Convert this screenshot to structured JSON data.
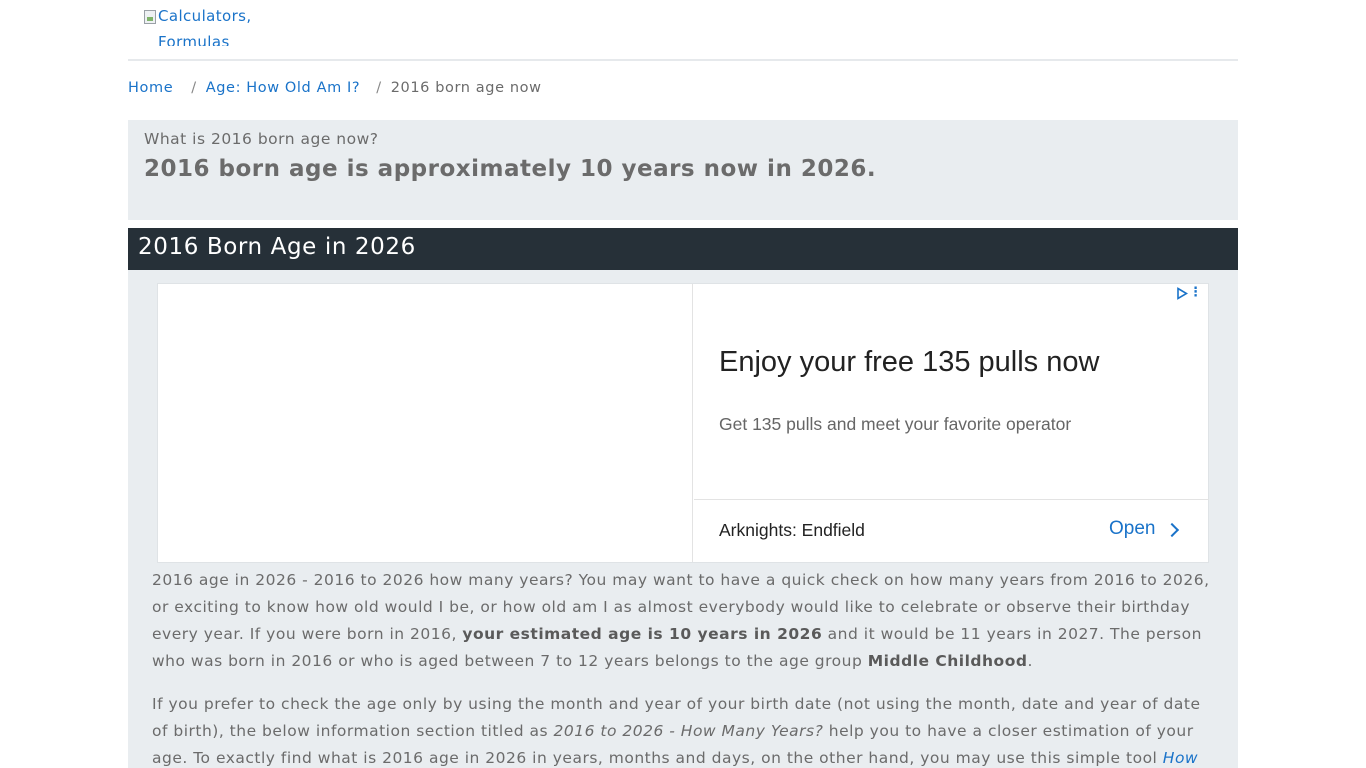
{
  "header": {
    "logo_alt": "Calculators, Formulas and"
  },
  "breadcrumb": {
    "home": "Home",
    "parent": "Age: How Old Am I?",
    "separator": "/",
    "current": "2016 born age now"
  },
  "answer": {
    "question": "What is 2016 born age now?",
    "text": "2016 born age is approximately 10 years now in 2026."
  },
  "section": {
    "title": "2016 Born Age in 2026"
  },
  "ad": {
    "headline": "Enjoy your free 135 pulls now",
    "description": "Get 135 pulls and meet your favorite operator",
    "advertiser": "Arknights: Endfield",
    "cta": "Open",
    "adchoices_icon": "adchoices-icon",
    "menu_icon": "more-vert-icon"
  },
  "paragraph1": {
    "part1": "2016 age in 2026 - 2016 to 2026 how many years? You may want to have a quick check on how many years from 2016 to 2026, or exciting to know how old would I be, or how old am I as almost everybody would like to celebrate or observe their birthday every year. If you were born in 2016, ",
    "bold1": "your estimated age is 10 years in 2026",
    "part2": " and it would be 11 years in 2027. The person who was born in 2016 or who is aged between 7 to 12 years belongs to the age group ",
    "bold2": "Middle Childhood",
    "part3": "."
  },
  "paragraph2": {
    "part1": "If you prefer to check the age only by using the month and year of your birth date (not using the month, date and year of date of birth), the below information section titled as ",
    "italic1": "2016 to 2026 - How Many Years?",
    "part2": " help you to have a closer estimation of your age. To exactly find what is 2016 age in 2026 in years, months and days, on the other hand, you may use this simple tool ",
    "link": "How"
  },
  "colors": {
    "accent": "#1a73c9",
    "section_bar": "#263038",
    "panel": "#e9edf0"
  }
}
